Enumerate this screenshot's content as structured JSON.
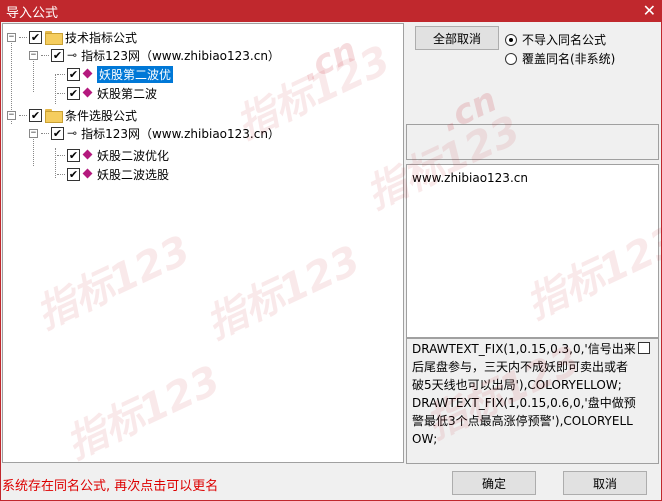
{
  "window": {
    "title": "导入公式",
    "close_glyph": "✕"
  },
  "tree": {
    "root1": {
      "expander": "−",
      "check": "✔",
      "label": "技术指标公式"
    },
    "root1_site": {
      "expander": "−",
      "check": "✔",
      "label": "指标123网（www.zhibiao123.cn）"
    },
    "root1_item1": {
      "check": "✔",
      "label": "妖股第二波优"
    },
    "root1_item2": {
      "check": "✔",
      "label": "妖股第二波"
    },
    "root2": {
      "expander": "−",
      "check": "✔",
      "label": "条件选股公式"
    },
    "root2_site": {
      "expander": "−",
      "check": "✔",
      "label": "指标123网（www.zhibiao123.cn）"
    },
    "root2_item1": {
      "check": "✔",
      "label": "妖股二波优化"
    },
    "root2_item2": {
      "check": "✔",
      "label": "妖股二波选股"
    }
  },
  "controls": {
    "cancel_all": "全部取消",
    "radio_no_import": "不导入同名公式",
    "radio_overwrite": "覆盖同名(非系统)"
  },
  "info": {
    "site": "www.zhibiao123.cn",
    "formula_text": "DRAWTEXT_FIX(1,0.15,0.3,0,'信号出来后尾盘参与，三天内不成妖即可卖出或者破5天线也可以出局'),COLORYELLOW;\nDRAWTEXT_FIX(1,0.15,0.6,0,'盘中做预警最低3个点最高涨停预警'),COLORYELLOW;"
  },
  "status": {
    "message": "系统存在同名公式, 再次点击可以更名"
  },
  "buttons": {
    "ok": "确定",
    "cancel": "取消"
  },
  "watermark": {
    "text": "指标123",
    "cn": ".cn"
  },
  "colors": {
    "title_bar": "#c0282d",
    "selection": "#0078d7",
    "status_text": "#d00000"
  }
}
